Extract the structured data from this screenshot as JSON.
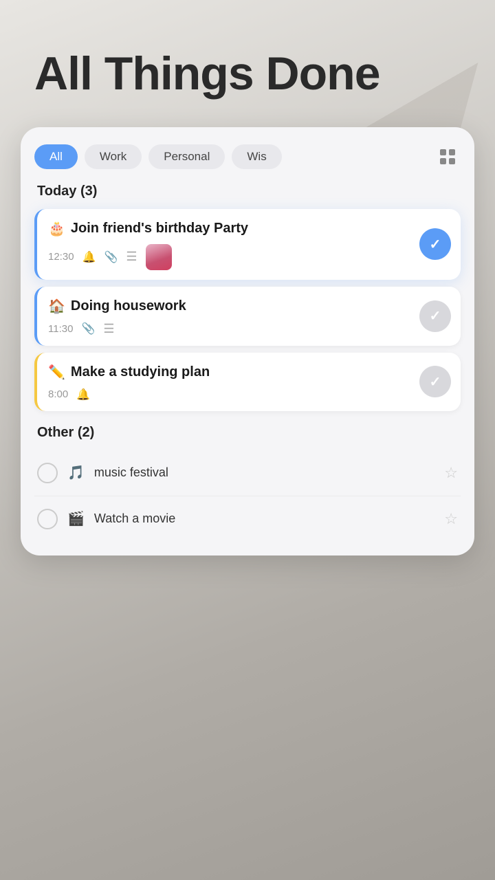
{
  "app": {
    "title": "All Things Done"
  },
  "tabs": {
    "items": [
      {
        "id": "all",
        "label": "All",
        "active": true
      },
      {
        "id": "work",
        "label": "Work",
        "active": false
      },
      {
        "id": "personal",
        "label": "Personal",
        "active": false
      },
      {
        "id": "wishlist",
        "label": "Wis",
        "active": false
      }
    ]
  },
  "today_section": {
    "header": "Today (3)",
    "tasks": [
      {
        "id": "task1",
        "emoji": "🎂",
        "title": "Join friend's birthday Party",
        "time": "12:30",
        "has_bell": true,
        "has_attachment": true,
        "has_list": true,
        "has_thumbnail": true,
        "done": true,
        "accent": "blue"
      },
      {
        "id": "task2",
        "emoji": "🏠",
        "title": "Doing housework",
        "time": "11:30",
        "has_bell": false,
        "has_attachment": true,
        "has_list": true,
        "has_thumbnail": false,
        "done": false,
        "accent": "blue"
      },
      {
        "id": "task3",
        "emoji": "✏️",
        "title": "Make a studying plan",
        "time": "8:00",
        "has_bell": true,
        "has_attachment": false,
        "has_list": false,
        "has_thumbnail": false,
        "done": false,
        "accent": "yellow"
      }
    ]
  },
  "other_section": {
    "header": "Other (2)",
    "tasks": [
      {
        "id": "other1",
        "emoji": "🎵",
        "label": "music festival",
        "starred": false
      },
      {
        "id": "other2",
        "emoji": "🎬",
        "label": "Watch a movie",
        "starred": false
      }
    ]
  },
  "icons": {
    "bell": "🔔",
    "attachment": "📎",
    "list": "≡",
    "checkmark": "✓",
    "star_empty": "☆",
    "grid": "⊞"
  }
}
